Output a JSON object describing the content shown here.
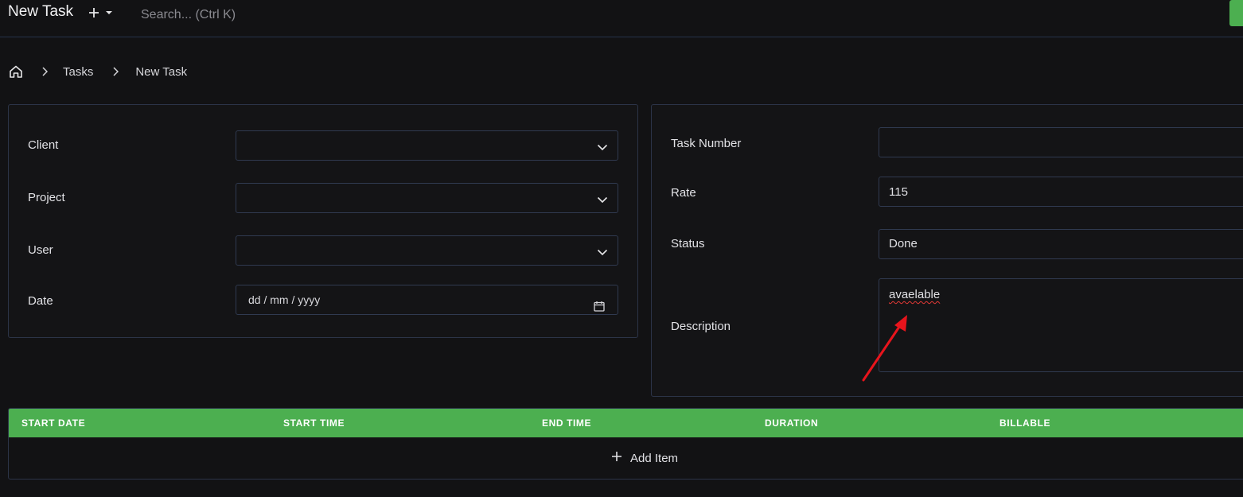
{
  "topbar": {
    "title": "New Task",
    "search_placeholder": "Search... (Ctrl K)"
  },
  "breadcrumb": {
    "items": [
      "Tasks",
      "New Task"
    ]
  },
  "left_form": {
    "client_label": "Client",
    "project_label": "Project",
    "user_label": "User",
    "date_label": "Date",
    "date_placeholder": "dd / mm / yyyy"
  },
  "right_form": {
    "task_number_label": "Task Number",
    "task_number_value": "",
    "rate_label": "Rate",
    "rate_value": "115",
    "status_label": "Status",
    "status_value": "Done",
    "description_label": "Description",
    "description_value": "avaelable"
  },
  "table": {
    "headers": [
      "START DATE",
      "START TIME",
      "END TIME",
      "DURATION",
      "BILLABLE"
    ],
    "add_item_label": "Add Item"
  },
  "colors": {
    "accent": "#4caf50",
    "background": "#121214",
    "border": "#2c3448",
    "annotation": "#e8141c"
  }
}
